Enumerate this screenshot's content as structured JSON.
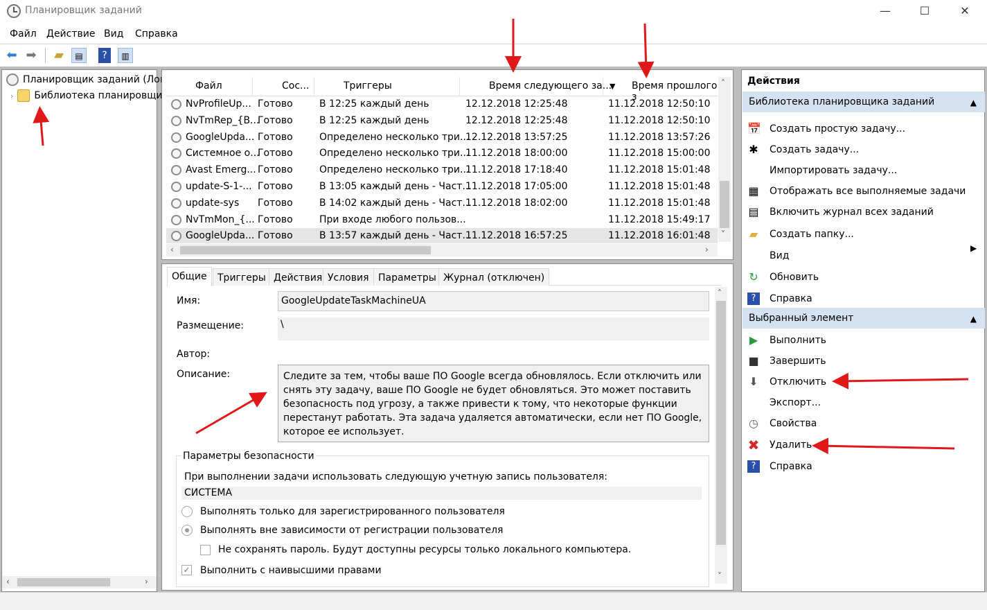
{
  "window": {
    "title": "Планировщик заданий",
    "minimize": "—",
    "maximize": "☐",
    "close": "✕"
  },
  "menu": [
    "Файл",
    "Действие",
    "Вид",
    "Справка"
  ],
  "tree": {
    "root": "Планировщик заданий (Лока",
    "library": "Библиотека планировщи"
  },
  "tasks": {
    "columns": [
      "Файл",
      "Сос...",
      "Триггеры",
      "Время следующего за...",
      "Время прошлого з"
    ],
    "sort_indicator": "▼",
    "rows": [
      [
        "NvProfileUp...",
        "Готово",
        "В 12:25 каждый день",
        "12.12.2018 12:25:48",
        "11.12.2018 12:50:10"
      ],
      [
        "NvTmRep_{B...",
        "Готово",
        "В 12:25 каждый день",
        "12.12.2018 12:25:48",
        "11.12.2018 12:50:10"
      ],
      [
        "GoogleUpda...",
        "Готово",
        "Определено несколько три...",
        "12.12.2018 13:57:25",
        "11.12.2018 13:57:26"
      ],
      [
        "Системное о...",
        "Готово",
        "Определено несколько три...",
        "11.12.2018 18:00:00",
        "11.12.2018 15:00:00"
      ],
      [
        "Avast Emerg...",
        "Готово",
        "Определено несколько три...",
        "11.12.2018 17:18:40",
        "11.12.2018 15:01:48"
      ],
      [
        "update-S-1-...",
        "Готово",
        "В 13:05 каждый день - Част...",
        "11.12.2018 17:05:00",
        "11.12.2018 15:01:48"
      ],
      [
        "update-sys",
        "Готово",
        "В 14:02 каждый день - Част...",
        "11.12.2018 18:02:00",
        "11.12.2018 15:01:48"
      ],
      [
        "NvTmMon_{...",
        "Готово",
        "При входе любого пользов...",
        "",
        "11.12.2018 15:49:17"
      ],
      [
        "GoogleUpda...",
        "Готово",
        "В 13:57 каждый день - Част...",
        "11.12.2018 16:57:25",
        "11.12.2018 16:01:48"
      ]
    ]
  },
  "details": {
    "tabs": [
      "Общие",
      "Триггеры",
      "Действия",
      "Условия",
      "Параметры",
      "Журнал (отключен)"
    ],
    "name_label": "Имя:",
    "name_value": "GoogleUpdateTaskMachineUA",
    "location_label": "Размещение:",
    "location_value": "\\",
    "author_label": "Автор:",
    "description_label": "Описание:",
    "description": "Следите за тем, чтобы ваше ПО Google всегда обновлялось. Если отключить или снять эту задачу, ваше ПО Google не будет обновляться. Это может поставить безопасность под угрозу, а также привести к тому, что некоторые функции перестанут работать. Эта задача удаляется автоматически, если нет ПО Google, которое ее использует.",
    "security": {
      "title": "Параметры безопасности",
      "account_prompt": "При выполнении задачи использовать следующую учетную запись пользователя:",
      "account": "СИСТЕМА",
      "radio1": "Выполнять только для зарегистрированного пользователя",
      "radio2": "Выполнять вне зависимости от регистрации пользователя",
      "no_password": "Не сохранять пароль. Будут доступны ресурсы только локального компьютера.",
      "highest": "Выполнить с наивысшими правами"
    }
  },
  "actions": {
    "title": "Действия",
    "section1": "Библиотека планировщика заданий",
    "items1": [
      "Создать простую задачу...",
      "Создать задачу...",
      "Импортировать задачу...",
      "Отображать все выполняемые задачи",
      "Включить журнал всех заданий",
      "Создать папку...",
      "Вид",
      "Обновить",
      "Справка"
    ],
    "section2": "Выбранный элемент",
    "items2": [
      "Выполнить",
      "Завершить",
      "Отключить",
      "Экспорт...",
      "Свойства",
      "Удалить",
      "Справка"
    ]
  },
  "icons": {
    "back": "arrow-left-icon",
    "forward": "arrow-right-icon",
    "folder_up": "folder-up-icon",
    "console_tree": "console-tree-icon",
    "help": "help-icon",
    "action_pane": "action-pane-icon"
  },
  "colors": {
    "accent": "#d5e2f1",
    "annotation": "#e0181a",
    "selected_row": "#e5e5e5"
  }
}
